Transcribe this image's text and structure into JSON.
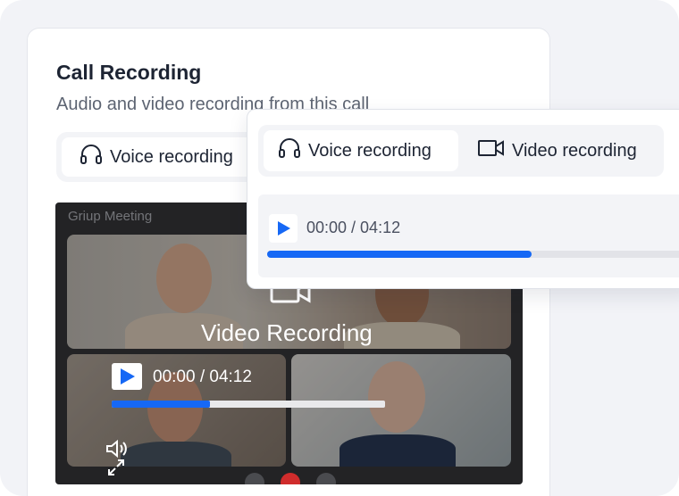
{
  "card": {
    "title": "Call Recording",
    "subtitle": "Audio and video recording from this call",
    "tab_voice": "Voice recording"
  },
  "video": {
    "title": "Griup Meeting",
    "overlay_label": "Video Recording",
    "time": "00:00 / 04:12",
    "progress": 0.36
  },
  "popup": {
    "tab_voice": "Voice recording",
    "tab_video": "Video recording",
    "time": "00:00 / 04:12",
    "progress": 0.62
  },
  "colors": {
    "accent": "#1668f5",
    "text": "#1d2433"
  },
  "icons": [
    "headphones-icon",
    "video-camera-icon",
    "play-icon",
    "volume-icon",
    "expand-icon"
  ]
}
